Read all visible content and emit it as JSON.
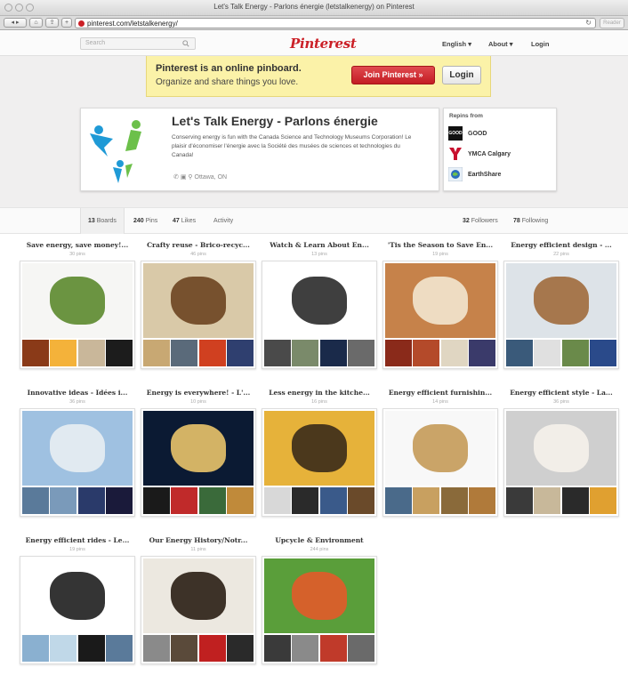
{
  "browser": {
    "window_title": "Let's Talk Energy - Parlons énergie (letstalkenergy) on Pinterest",
    "url": "pinterest.com/letstalkenergy/",
    "reader_label": "Reader"
  },
  "header": {
    "search_placeholder": "Search",
    "logo": "Pinterest",
    "nav": [
      "English",
      "About",
      "Login"
    ]
  },
  "banner": {
    "title": "Pinterest is an online pinboard.",
    "subtitle": "Organize and share things you love.",
    "join_label": "Join Pinterest",
    "login_label": "Login"
  },
  "profile": {
    "name": "Let's Talk Energy - Parlons énergie",
    "description": "Conserving energy is fun with the Canada Science and Technology Museums Corporation! Le plaisir d'économiser l'énergie avec la Société des musées de sciences et technologies du Canada!",
    "location": "Ottawa, ON",
    "logo_colors": [
      "#1f9ad6",
      "#6cc04a"
    ]
  },
  "repins": {
    "title": "Repins from",
    "items": [
      {
        "name": "GOOD",
        "color": "#111111"
      },
      {
        "name": "YMCA Calgary",
        "color": "#c8102e"
      },
      {
        "name": "EarthShare",
        "color": "#2a6ebb"
      }
    ]
  },
  "tabs": {
    "boards": {
      "count": "13",
      "label": "Boards"
    },
    "pins": {
      "count": "240",
      "label": "Pins"
    },
    "likes": {
      "count": "47",
      "label": "Likes"
    },
    "activity": {
      "label": "Activity"
    },
    "followers": {
      "count": "32",
      "label": "Followers"
    },
    "following": {
      "count": "78",
      "label": "Following"
    }
  },
  "boards": [
    {
      "title": "Save energy, save money!...",
      "count": "30 pins",
      "main": [
        "#f6f6f4",
        "#5c8a2e"
      ],
      "thumbs": [
        "#8a3a18",
        "#f4b23a",
        "#c9b79a",
        "#1c1c1c"
      ]
    },
    {
      "title": "Crafty reuse - Brico-recyc...",
      "count": "46 pins",
      "main": [
        "#d9c9a8",
        "#6b4420"
      ],
      "thumbs": [
        "#c8a873",
        "#5a6a7a",
        "#d04020",
        "#2f3f6f"
      ]
    },
    {
      "title": "Watch & Learn About En...",
      "count": "13 pins",
      "main": [
        "#ffffff",
        "#2a2a2a"
      ],
      "thumbs": [
        "#4a4a4a",
        "#7a8a6a",
        "#1a2a4a",
        "#6a6a6a"
      ]
    },
    {
      "title": "'Tis the Season to Save En...",
      "count": "19 pins",
      "main": [
        "#c6824a",
        "#f2e6cf"
      ],
      "thumbs": [
        "#8a2a1a",
        "#b44a2a",
        "#e0d6c2",
        "#3a3a6a"
      ]
    },
    {
      "title": "Energy efficient design - ...",
      "count": "22 pins",
      "main": [
        "#dde3e8",
        "#a06a3c"
      ],
      "thumbs": [
        "#3a5a7a",
        "#e0e0e0",
        "#6a8a4a",
        "#2a4a8a"
      ]
    },
    {
      "title": "Innovative ideas - Idées i...",
      "count": "36 pins",
      "main": [
        "#9fc1e1",
        "#e8eef3"
      ],
      "thumbs": [
        "#5a7a9a",
        "#7a9aba",
        "#2a3a6a",
        "#1a1a3a"
      ]
    },
    {
      "title": "Energy is everywhere! - L'...",
      "count": "10 pins",
      "main": [
        "#0b1a33",
        "#e9c46a"
      ],
      "thumbs": [
        "#1a1a1a",
        "#c02a2a",
        "#3a6a3a",
        "#c08a3a"
      ]
    },
    {
      "title": "Less energy in the kitche...",
      "count": "16 pins",
      "main": [
        "#e6b23a",
        "#3a2a1a"
      ],
      "thumbs": [
        "#d8d8d8",
        "#2a2a2a",
        "#3a5a8a",
        "#6a4a2a"
      ]
    },
    {
      "title": "Energy efficient furnishin...",
      "count": "14 pins",
      "main": [
        "#f8f8f8",
        "#c49a58"
      ],
      "thumbs": [
        "#4a6a8a",
        "#c8a060",
        "#8a6a3a",
        "#b07a3a"
      ]
    },
    {
      "title": "Energy efficient style - La...",
      "count": "36 pins",
      "main": [
        "#cfcfcf",
        "#f5f1ea"
      ],
      "thumbs": [
        "#3a3a3a",
        "#c8b89a",
        "#2a2a2a",
        "#e0a030"
      ]
    },
    {
      "title": "Energy efficient rides - Le...",
      "count": "19 pins",
      "main": [
        "#ffffff",
        "#1e1e1e"
      ],
      "thumbs": [
        "#8ab0d0",
        "#c0d8e8",
        "#1a1a1a",
        "#5a7a9a"
      ]
    },
    {
      "title": "Our Energy History/Notr...",
      "count": "11 pins",
      "main": [
        "#ece8e0",
        "#2a1e14"
      ],
      "thumbs": [
        "#8a8a8a",
        "#5a4a3a",
        "#c02020",
        "#2a2a2a"
      ]
    },
    {
      "title": "Upcycle & Environment",
      "count": "244 pins",
      "main": [
        "#5a9e3a",
        "#e25a2a"
      ],
      "thumbs": [
        "#3a3a3a",
        "#8a8a8a",
        "#c03a2a",
        "#6a6a6a"
      ]
    }
  ]
}
